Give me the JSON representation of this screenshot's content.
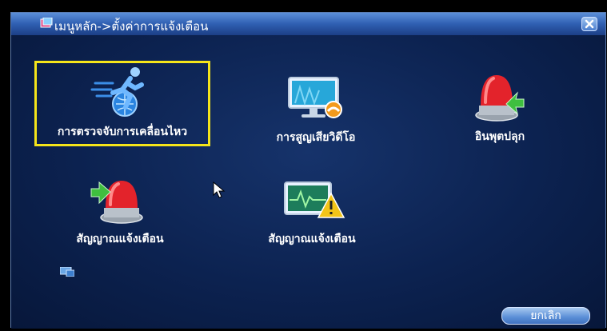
{
  "window": {
    "title": "เมนูหลัก->ตั้งค่าการแจ้งเตือน"
  },
  "items": [
    {
      "label": "การตรวจจับการเคลื่อนไหว",
      "icon": "running-man-icon"
    },
    {
      "label": "การสูญเสียวิดีโอ",
      "icon": "monitor-video-loss-icon"
    },
    {
      "label": "อินพุตปลุก",
      "icon": "alarm-input-icon"
    },
    {
      "label": "สัญญาณแจ้งเตือน",
      "icon": "alarm-output-icon"
    },
    {
      "label": "สัญญาณแจ้งเตือน",
      "icon": "abnormal-warning-icon"
    }
  ],
  "buttons": {
    "cancel_label": "ยกเลิก"
  },
  "colors": {
    "selection": "#f5e51a",
    "background": "#0b1d3e",
    "titlebar": "#2f5fb2"
  }
}
